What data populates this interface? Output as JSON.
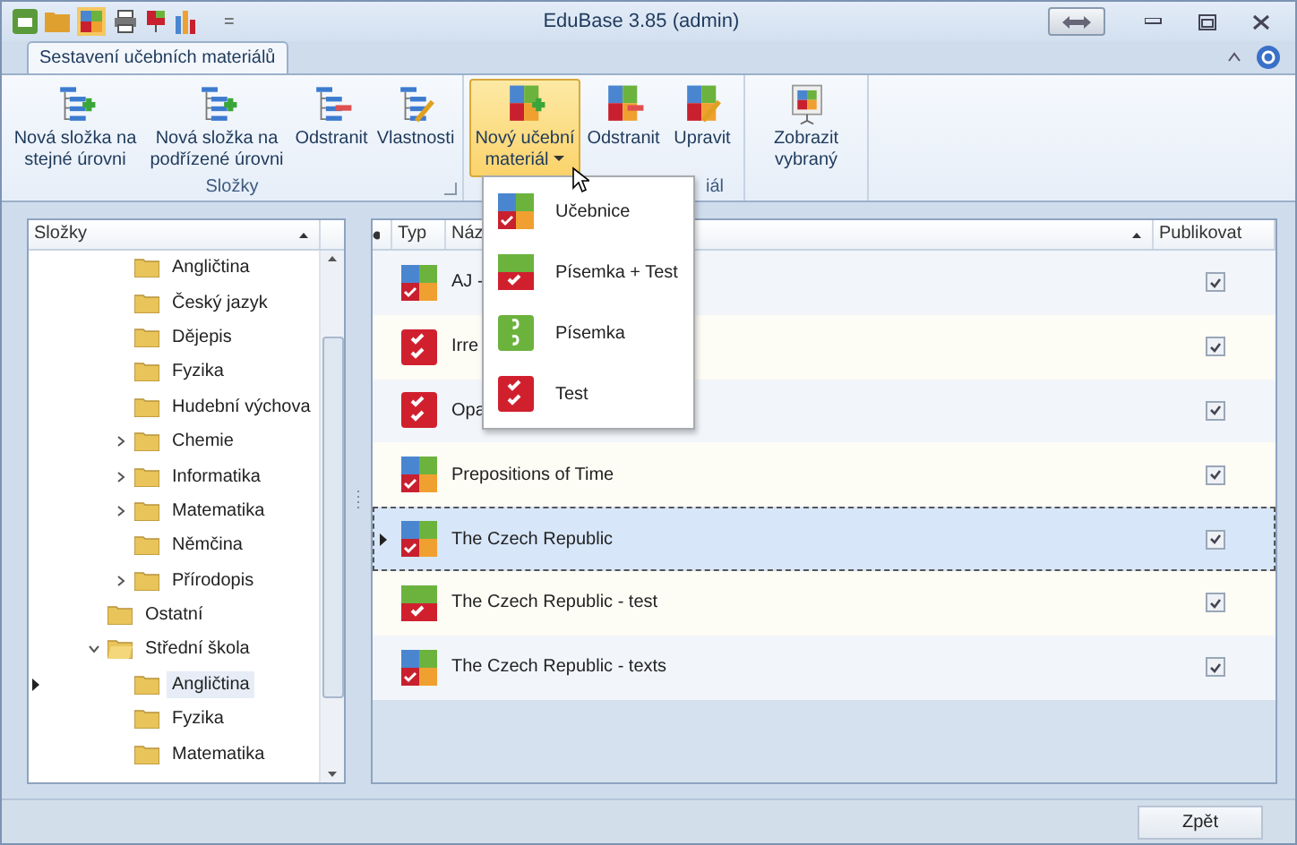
{
  "window": {
    "title": "EduBase 3.85 (admin)"
  },
  "quick_access": {
    "customize": "="
  },
  "tabs": [
    {
      "label": "Sestavení učebních materiálů",
      "selected": true
    }
  ],
  "ribbon": {
    "groups": [
      {
        "label": "Složky",
        "launcher": true,
        "buttons": [
          {
            "label": "Nová složka na stejné úrovni",
            "active": false,
            "dropdown": false
          },
          {
            "label": "Nová složka na podřízené úrovni",
            "active": false,
            "dropdown": false
          },
          {
            "label": "Odstranit",
            "active": false,
            "dropdown": false
          },
          {
            "label": "Vlastnosti",
            "active": false,
            "dropdown": false
          }
        ]
      },
      {
        "label": "iál",
        "launcher": false,
        "buttons": [
          {
            "label": "Nový učební materiál",
            "active": true,
            "dropdown": true
          },
          {
            "label": "Odstranit",
            "active": false,
            "dropdown": false
          },
          {
            "label": "Upravit",
            "active": false,
            "dropdown": false
          }
        ]
      },
      {
        "launcher": false,
        "buttons": [
          {
            "label": "Zobrazit vybraný",
            "active": false,
            "dropdown": false
          }
        ]
      }
    ]
  },
  "menu": {
    "items": [
      {
        "label": "Učebnice",
        "kind": "ucebnice"
      },
      {
        "label": "Písemka + Test",
        "kind": "pisemka_test"
      },
      {
        "label": "Písemka",
        "kind": "pisemka"
      },
      {
        "label": "Test",
        "kind": "test"
      }
    ]
  },
  "tree": {
    "header": "Složky",
    "continued_children": [
      {
        "label": "Angličtina",
        "has_children": false,
        "expanded": false,
        "selected": false
      },
      {
        "label": "Český jazyk",
        "has_children": false,
        "expanded": false,
        "selected": false
      },
      {
        "label": "Dějepis",
        "has_children": false,
        "expanded": false,
        "selected": false
      },
      {
        "label": "Fyzika",
        "has_children": false,
        "expanded": false,
        "selected": false
      },
      {
        "label": "Hudební výchova",
        "has_children": false,
        "expanded": false,
        "selected": false
      },
      {
        "label": "Chemie",
        "has_children": true,
        "expanded": false,
        "selected": false
      },
      {
        "label": "Informatika",
        "has_children": true,
        "expanded": false,
        "selected": false
      },
      {
        "label": "Matematika",
        "has_children": true,
        "expanded": false,
        "selected": false
      },
      {
        "label": "Němčina",
        "has_children": false,
        "expanded": false,
        "selected": false
      },
      {
        "label": "Přírodopis",
        "has_children": true,
        "expanded": false,
        "selected": false
      }
    ],
    "items": [
      {
        "label": "Ostatní",
        "has_children": false,
        "expanded": false,
        "selected": false
      },
      {
        "label": "Střední škola",
        "has_children": true,
        "expanded": true,
        "selected": false,
        "children": [
          {
            "label": "Angličtina",
            "has_children": false,
            "expanded": false,
            "selected": true
          },
          {
            "label": "Fyzika",
            "has_children": false,
            "expanded": false,
            "selected": false
          },
          {
            "label": "Matematika",
            "has_children": false,
            "expanded": false,
            "selected": false
          }
        ]
      }
    ]
  },
  "table": {
    "columns": [
      "Typ",
      "Náz",
      "Publikovat"
    ],
    "rows": [
      {
        "kind": "ucebnice",
        "name": "AJ -",
        "publish": true,
        "selected": false
      },
      {
        "kind": "test",
        "name": "Irre",
        "publish": true,
        "selected": false
      },
      {
        "kind": "test",
        "name": "Opa",
        "publish": true,
        "selected": false
      },
      {
        "kind": "ucebnice",
        "name": "Prepositions of Time",
        "publish": true,
        "selected": false
      },
      {
        "kind": "ucebnice",
        "name": "The Czech Republic",
        "publish": true,
        "selected": true
      },
      {
        "kind": "pisemka_test",
        "name": "The Czech Republic - test",
        "publish": true,
        "selected": false
      },
      {
        "kind": "ucebnice",
        "name": "The Czech Republic - texts",
        "publish": true,
        "selected": false
      }
    ]
  },
  "status_bar": {
    "button": "Zpět"
  }
}
